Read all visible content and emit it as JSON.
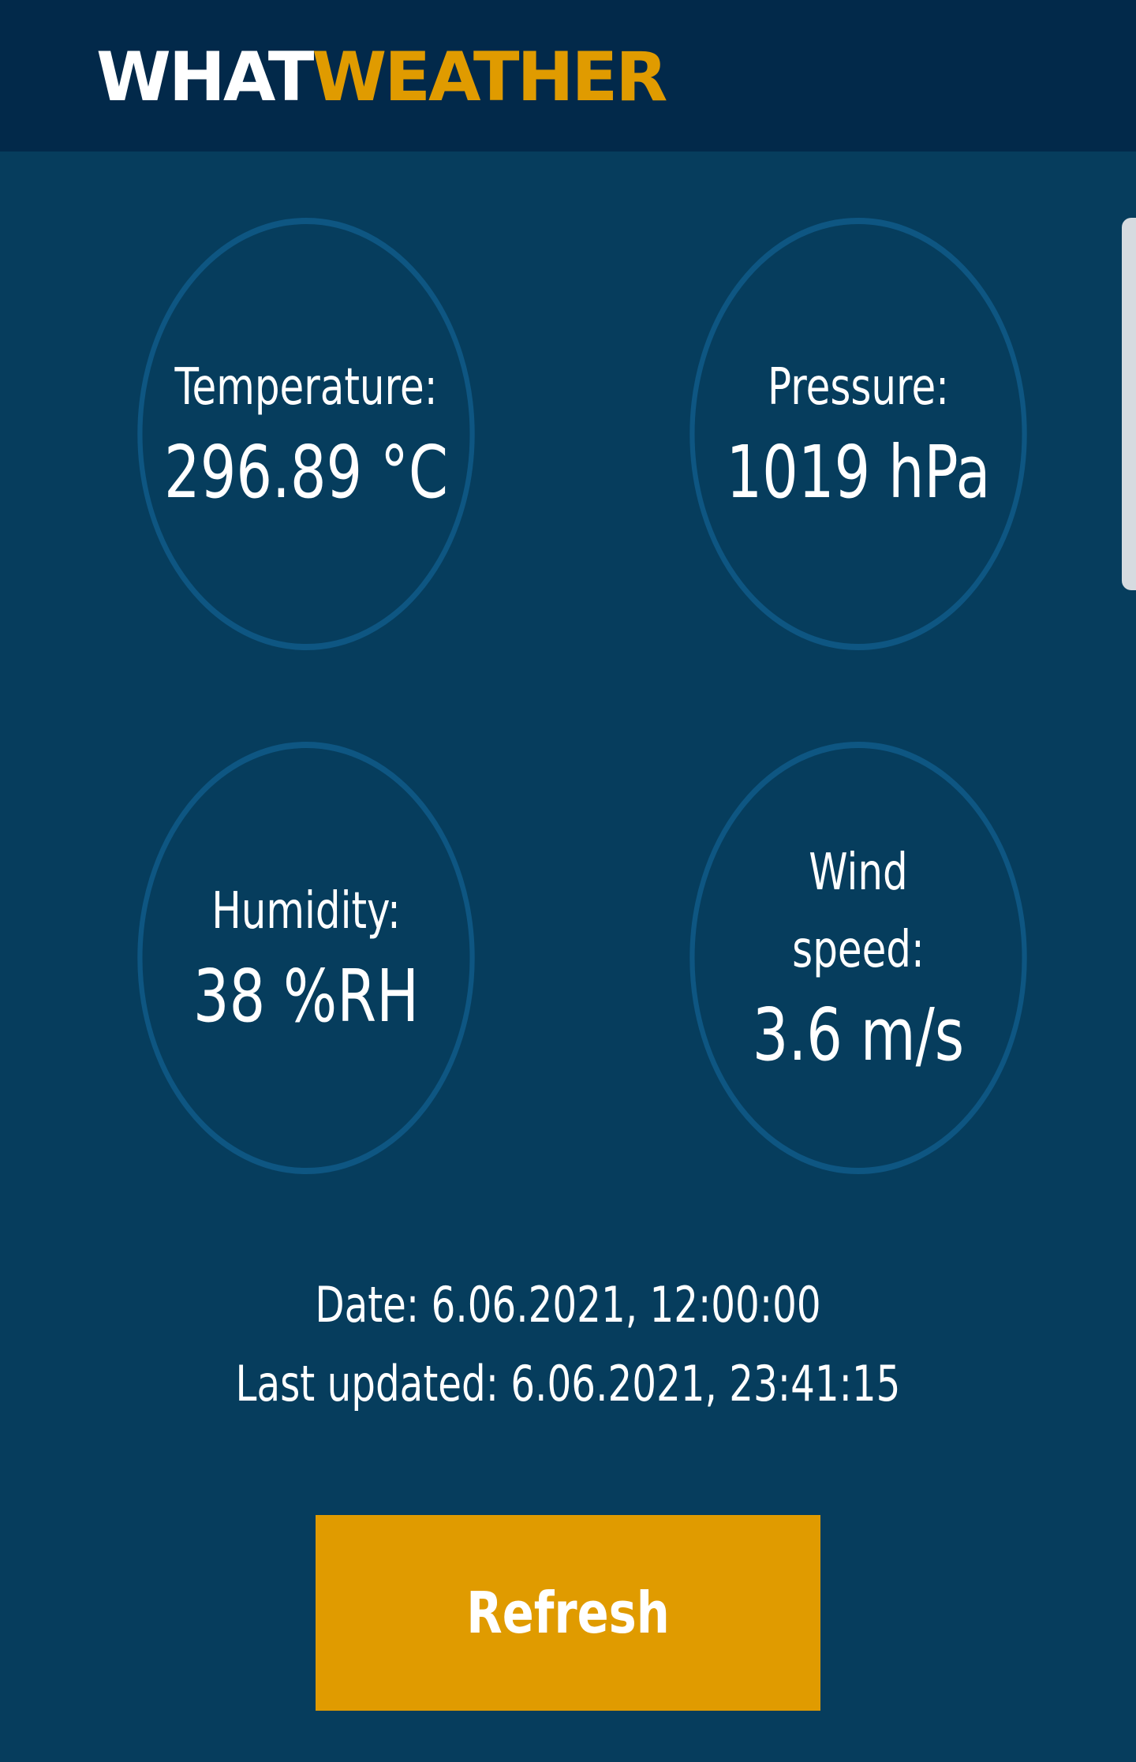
{
  "header": {
    "logo_part1": "WHAT",
    "logo_part2": "WEATHER"
  },
  "cards": {
    "temperature": {
      "label": "Temperature:",
      "value": "296.89 °C"
    },
    "pressure": {
      "label": "Pressure:",
      "value": "1019 hPa"
    },
    "humidity": {
      "label": "Humidity:",
      "value": "38 %RH"
    },
    "wind": {
      "label_line1": "Wind",
      "label_line2": "speed:",
      "value": "3.6 m/s"
    }
  },
  "meta": {
    "date": "Date: 6.06.2021, 12:00:00",
    "last_updated": "Last updated: 6.06.2021, 23:41:15"
  },
  "actions": {
    "refresh_label": "Refresh"
  },
  "colors": {
    "background": "#063d5d",
    "header": "#02294a",
    "accent": "#e09b00",
    "circle_border": "#0e5682"
  }
}
